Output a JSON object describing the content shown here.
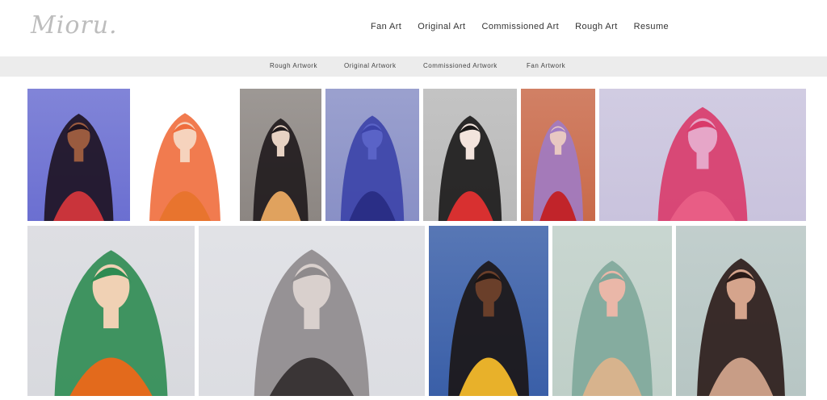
{
  "site": {
    "logo_text": "Mioru."
  },
  "nav": {
    "items": [
      {
        "label": "Fan Art"
      },
      {
        "label": "Original Art"
      },
      {
        "label": "Commissioned Art"
      },
      {
        "label": "Rough Art"
      },
      {
        "label": "Resume"
      }
    ]
  },
  "subnav": {
    "items": [
      {
        "label": "Rough Artwork"
      },
      {
        "label": "Original Artwork"
      },
      {
        "label": "Commissioned Artwork"
      },
      {
        "label": "Fan Artwork"
      }
    ]
  },
  "gallery": {
    "row1": [
      {
        "name": "artwork-red-hat-woman",
        "bg": "#6b6fd1",
        "accent": "#c9343b",
        "skin": "#9a5b3f",
        "hair": "#1d1220"
      },
      {
        "name": "artwork-horned-girl-sketch",
        "bg": "#ffffff",
        "accent": "#e8742e",
        "skin": "#f6d3bd",
        "hair": "#ef6d3c"
      },
      {
        "name": "artwork-dark-smoke-girl",
        "bg": "#8c8682",
        "accent": "#e0a25e",
        "skin": "#e7d2c3",
        "hair": "#1f1a1c"
      },
      {
        "name": "artwork-blue-alien-woman",
        "bg": "#8990c6",
        "accent": "#2a2e86",
        "skin": "#5a63c7",
        "hair": "#3b42a8"
      },
      {
        "name": "artwork-elf-with-wine",
        "bg": "#b9b9b9",
        "accent": "#d83030",
        "skin": "#f3e4dd",
        "hair": "#1a1818"
      },
      {
        "name": "artwork-rose-demon-girl",
        "bg": "#c96a4a",
        "accent": "#c1242a",
        "skin": "#e8c8c2",
        "hair": "#a07bc4"
      },
      {
        "name": "artwork-three-girls",
        "bg": "#c9c3dd",
        "accent": "#e85d85",
        "skin": "#e6a6c8",
        "hair": "#d93a6a"
      }
    ],
    "row2": [
      {
        "name": "artwork-witch-pumpkins",
        "bg": "#d8d9de",
        "accent": "#e36a1c",
        "skin": "#f0d1b4",
        "hair": "#2e8b52"
      },
      {
        "name": "artwork-horned-silver-hair",
        "bg": "#dcdde2",
        "accent": "#3a3536",
        "skin": "#d9d0cd",
        "hair": "#8e8a8c"
      },
      {
        "name": "artwork-forest-sorceress",
        "bg": "#3a5fa8",
        "accent": "#e8b12a",
        "skin": "#6a3f2a",
        "hair": "#1b1514"
      },
      {
        "name": "artwork-green-hair-floral",
        "bg": "#bfcfc8",
        "accent": "#d7b38d",
        "skin": "#eab7a8",
        "hair": "#7ea79a"
      },
      {
        "name": "artwork-fox-ear-girl",
        "bg": "#b7c6c4",
        "accent": "#c89d86",
        "skin": "#d5a48c",
        "hair": "#2a1a17"
      }
    ]
  }
}
